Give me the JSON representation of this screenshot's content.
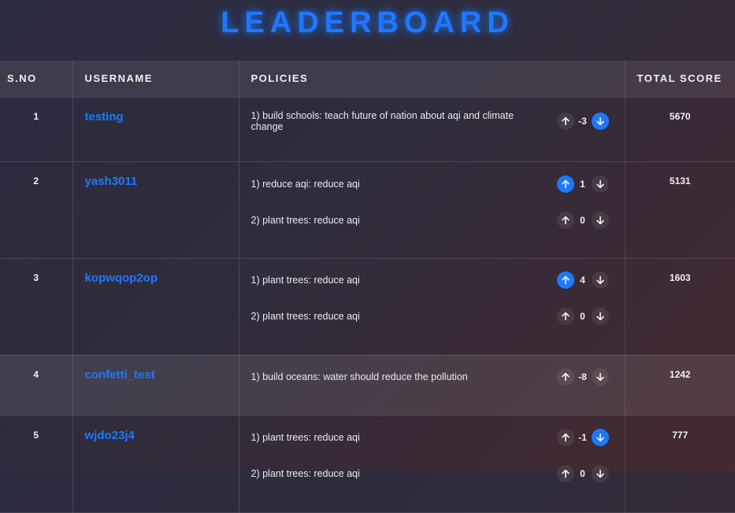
{
  "title": "LEADERBOARD",
  "columns": [
    "S.NO",
    "USERNAME",
    "POLICIES",
    "TOTAL SCORE"
  ],
  "colors": {
    "accent": "#1e78ff"
  },
  "rows": [
    {
      "sno": "1",
      "username": "testing",
      "score": "5670",
      "policies": [
        {
          "text": "1) build schools: teach future of nation about aqi and climate change",
          "votes": "-3",
          "voted": "down"
        }
      ]
    },
    {
      "sno": "2",
      "username": "yash3011",
      "score": "5131",
      "policies": [
        {
          "text": "1) reduce aqi: reduce aqi",
          "votes": "1",
          "voted": "up"
        },
        {
          "text": "2) plant trees: reduce aqi",
          "votes": "0",
          "voted": "none"
        }
      ]
    },
    {
      "sno": "3",
      "username": "kopwqop2op",
      "score": "1603",
      "policies": [
        {
          "text": "1) plant trees: reduce aqi",
          "votes": "4",
          "voted": "up"
        },
        {
          "text": "2) plant trees: reduce aqi",
          "votes": "0",
          "voted": "none"
        }
      ]
    },
    {
      "sno": "4",
      "username": "confetti_test",
      "score": "1242",
      "policies": [
        {
          "text": "1) build oceans: water should reduce the pollution",
          "votes": "-8",
          "voted": "none"
        }
      ]
    },
    {
      "sno": "5",
      "username": "wjdo23j4",
      "score": "777",
      "policies": [
        {
          "text": "1) plant trees: reduce aqi",
          "votes": "-1",
          "voted": "down"
        },
        {
          "text": "2) plant trees: reduce aqi",
          "votes": "0",
          "voted": "none"
        }
      ]
    }
  ]
}
